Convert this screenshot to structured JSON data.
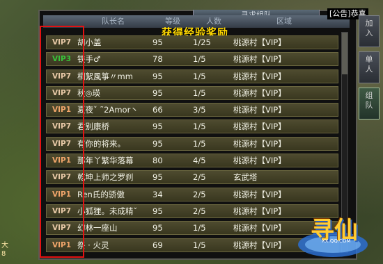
{
  "window": {
    "title": "寻求组队"
  },
  "header": {
    "col_leader": "队长名",
    "col_level": "等级",
    "col_count": "人数",
    "col_area": "区域"
  },
  "reward_text": "获得经验奖励",
  "notice": "[公告]恭喜",
  "side_tabs": [
    {
      "label": "加\n入"
    },
    {
      "label": "单\n人"
    },
    {
      "label": "组\n队"
    }
  ],
  "left_digits": "大\n8",
  "rows": [
    {
      "vip": "VIP7",
      "vip_color": "#e7c8a6",
      "name": "胡小盖",
      "level": "95",
      "count": "1/25",
      "area": "桃源村【VIP】"
    },
    {
      "vip": "VIP3",
      "vip_color": "#38c23a",
      "name": "铁手♂",
      "level": "78",
      "count": "1/5",
      "area": "桃源村【VIP】"
    },
    {
      "vip": "VIP7",
      "vip_color": "#e7c8a6",
      "name": "桐絮風箏〃mm",
      "level": "95",
      "count": "1/5",
      "area": "桃源村【VIP】"
    },
    {
      "vip": "VIP7",
      "vip_color": "#e7c8a6",
      "name": "秋◎瑛",
      "level": "95",
      "count": "1/5",
      "area": "桃源村【VIP】"
    },
    {
      "vip": "VIP1",
      "vip_color": "#f0a56a",
      "name": "夏夜ˇ ˜2Amor丶",
      "level": "66",
      "count": "3/5",
      "area": "桃源村【VIP】"
    },
    {
      "vip": "VIP7",
      "vip_color": "#e7c8a6",
      "name": "君别康桥",
      "level": "95",
      "count": "1/5",
      "area": "桃源村【VIP】"
    },
    {
      "vip": "VIP7",
      "vip_color": "#e7c8a6",
      "name": "有你的将来。",
      "level": "95",
      "count": "1/5",
      "area": "桃源村【VIP】"
    },
    {
      "vip": "VIP1",
      "vip_color": "#f0a56a",
      "name": "那年丫繁华落幕",
      "level": "80",
      "count": "4/5",
      "area": "桃源村【VIP】"
    },
    {
      "vip": "VIP7",
      "vip_color": "#e7c8a6",
      "name": "乾坤上师之罗刹",
      "level": "95",
      "count": "2/5",
      "area": "玄武塔"
    },
    {
      "vip": "VIP1",
      "vip_color": "#f0a56a",
      "name": "Ren氏的骄傲",
      "level": "34",
      "count": "2/5",
      "area": "桃源村【VIP】"
    },
    {
      "vip": "VIP7",
      "vip_color": "#e7c8a6",
      "name": "小狐狸。未成精ˇ",
      "level": "95",
      "count": "2/5",
      "area": "桃源村【VIP】"
    },
    {
      "vip": "VIP7",
      "vip_color": "#e7c8a6",
      "name": "幻林一座山",
      "level": "95",
      "count": "1/5",
      "area": "桃源村【VIP】"
    },
    {
      "vip": "VIP1",
      "vip_color": "#f0a56a",
      "name": "祭 · 火灵",
      "level": "69",
      "count": "1/5",
      "area": "桃源村【VIP】"
    }
  ],
  "logo": {
    "title": "寻仙",
    "subtitle": "XX.QQ.COM"
  }
}
